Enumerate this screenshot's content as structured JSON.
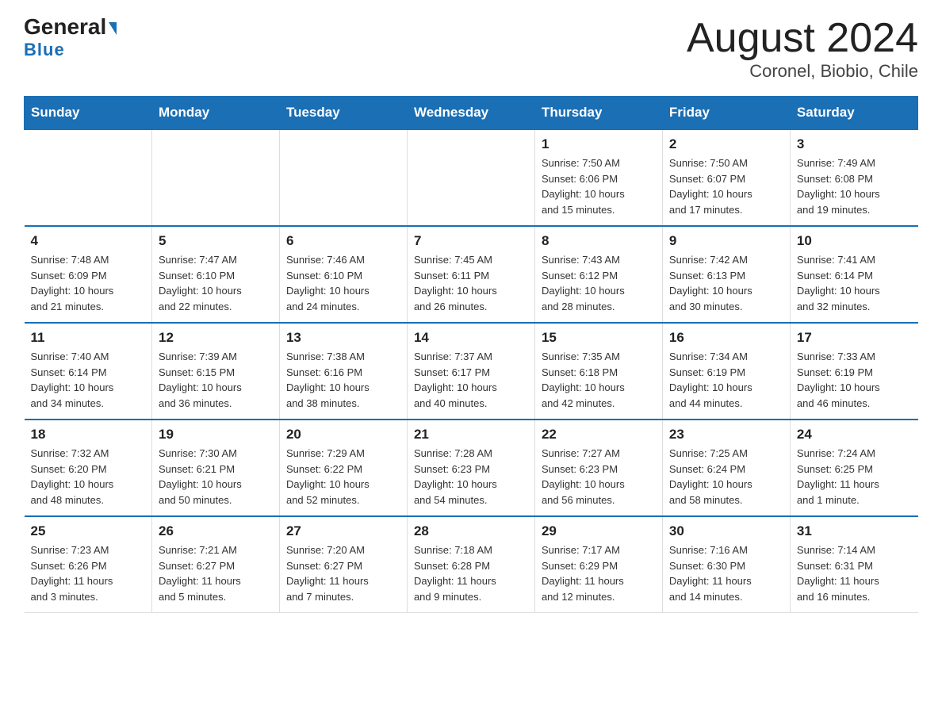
{
  "header": {
    "logo_general": "General",
    "logo_blue": "Blue",
    "title": "August 2024",
    "subtitle": "Coronel, Biobio, Chile"
  },
  "days_of_week": [
    "Sunday",
    "Monday",
    "Tuesday",
    "Wednesday",
    "Thursday",
    "Friday",
    "Saturday"
  ],
  "weeks": [
    [
      {
        "day": "",
        "info": ""
      },
      {
        "day": "",
        "info": ""
      },
      {
        "day": "",
        "info": ""
      },
      {
        "day": "",
        "info": ""
      },
      {
        "day": "1",
        "info": "Sunrise: 7:50 AM\nSunset: 6:06 PM\nDaylight: 10 hours\nand 15 minutes."
      },
      {
        "day": "2",
        "info": "Sunrise: 7:50 AM\nSunset: 6:07 PM\nDaylight: 10 hours\nand 17 minutes."
      },
      {
        "day": "3",
        "info": "Sunrise: 7:49 AM\nSunset: 6:08 PM\nDaylight: 10 hours\nand 19 minutes."
      }
    ],
    [
      {
        "day": "4",
        "info": "Sunrise: 7:48 AM\nSunset: 6:09 PM\nDaylight: 10 hours\nand 21 minutes."
      },
      {
        "day": "5",
        "info": "Sunrise: 7:47 AM\nSunset: 6:10 PM\nDaylight: 10 hours\nand 22 minutes."
      },
      {
        "day": "6",
        "info": "Sunrise: 7:46 AM\nSunset: 6:10 PM\nDaylight: 10 hours\nand 24 minutes."
      },
      {
        "day": "7",
        "info": "Sunrise: 7:45 AM\nSunset: 6:11 PM\nDaylight: 10 hours\nand 26 minutes."
      },
      {
        "day": "8",
        "info": "Sunrise: 7:43 AM\nSunset: 6:12 PM\nDaylight: 10 hours\nand 28 minutes."
      },
      {
        "day": "9",
        "info": "Sunrise: 7:42 AM\nSunset: 6:13 PM\nDaylight: 10 hours\nand 30 minutes."
      },
      {
        "day": "10",
        "info": "Sunrise: 7:41 AM\nSunset: 6:14 PM\nDaylight: 10 hours\nand 32 minutes."
      }
    ],
    [
      {
        "day": "11",
        "info": "Sunrise: 7:40 AM\nSunset: 6:14 PM\nDaylight: 10 hours\nand 34 minutes."
      },
      {
        "day": "12",
        "info": "Sunrise: 7:39 AM\nSunset: 6:15 PM\nDaylight: 10 hours\nand 36 minutes."
      },
      {
        "day": "13",
        "info": "Sunrise: 7:38 AM\nSunset: 6:16 PM\nDaylight: 10 hours\nand 38 minutes."
      },
      {
        "day": "14",
        "info": "Sunrise: 7:37 AM\nSunset: 6:17 PM\nDaylight: 10 hours\nand 40 minutes."
      },
      {
        "day": "15",
        "info": "Sunrise: 7:35 AM\nSunset: 6:18 PM\nDaylight: 10 hours\nand 42 minutes."
      },
      {
        "day": "16",
        "info": "Sunrise: 7:34 AM\nSunset: 6:19 PM\nDaylight: 10 hours\nand 44 minutes."
      },
      {
        "day": "17",
        "info": "Sunrise: 7:33 AM\nSunset: 6:19 PM\nDaylight: 10 hours\nand 46 minutes."
      }
    ],
    [
      {
        "day": "18",
        "info": "Sunrise: 7:32 AM\nSunset: 6:20 PM\nDaylight: 10 hours\nand 48 minutes."
      },
      {
        "day": "19",
        "info": "Sunrise: 7:30 AM\nSunset: 6:21 PM\nDaylight: 10 hours\nand 50 minutes."
      },
      {
        "day": "20",
        "info": "Sunrise: 7:29 AM\nSunset: 6:22 PM\nDaylight: 10 hours\nand 52 minutes."
      },
      {
        "day": "21",
        "info": "Sunrise: 7:28 AM\nSunset: 6:23 PM\nDaylight: 10 hours\nand 54 minutes."
      },
      {
        "day": "22",
        "info": "Sunrise: 7:27 AM\nSunset: 6:23 PM\nDaylight: 10 hours\nand 56 minutes."
      },
      {
        "day": "23",
        "info": "Sunrise: 7:25 AM\nSunset: 6:24 PM\nDaylight: 10 hours\nand 58 minutes."
      },
      {
        "day": "24",
        "info": "Sunrise: 7:24 AM\nSunset: 6:25 PM\nDaylight: 11 hours\nand 1 minute."
      }
    ],
    [
      {
        "day": "25",
        "info": "Sunrise: 7:23 AM\nSunset: 6:26 PM\nDaylight: 11 hours\nand 3 minutes."
      },
      {
        "day": "26",
        "info": "Sunrise: 7:21 AM\nSunset: 6:27 PM\nDaylight: 11 hours\nand 5 minutes."
      },
      {
        "day": "27",
        "info": "Sunrise: 7:20 AM\nSunset: 6:27 PM\nDaylight: 11 hours\nand 7 minutes."
      },
      {
        "day": "28",
        "info": "Sunrise: 7:18 AM\nSunset: 6:28 PM\nDaylight: 11 hours\nand 9 minutes."
      },
      {
        "day": "29",
        "info": "Sunrise: 7:17 AM\nSunset: 6:29 PM\nDaylight: 11 hours\nand 12 minutes."
      },
      {
        "day": "30",
        "info": "Sunrise: 7:16 AM\nSunset: 6:30 PM\nDaylight: 11 hours\nand 14 minutes."
      },
      {
        "day": "31",
        "info": "Sunrise: 7:14 AM\nSunset: 6:31 PM\nDaylight: 11 hours\nand 16 minutes."
      }
    ]
  ]
}
